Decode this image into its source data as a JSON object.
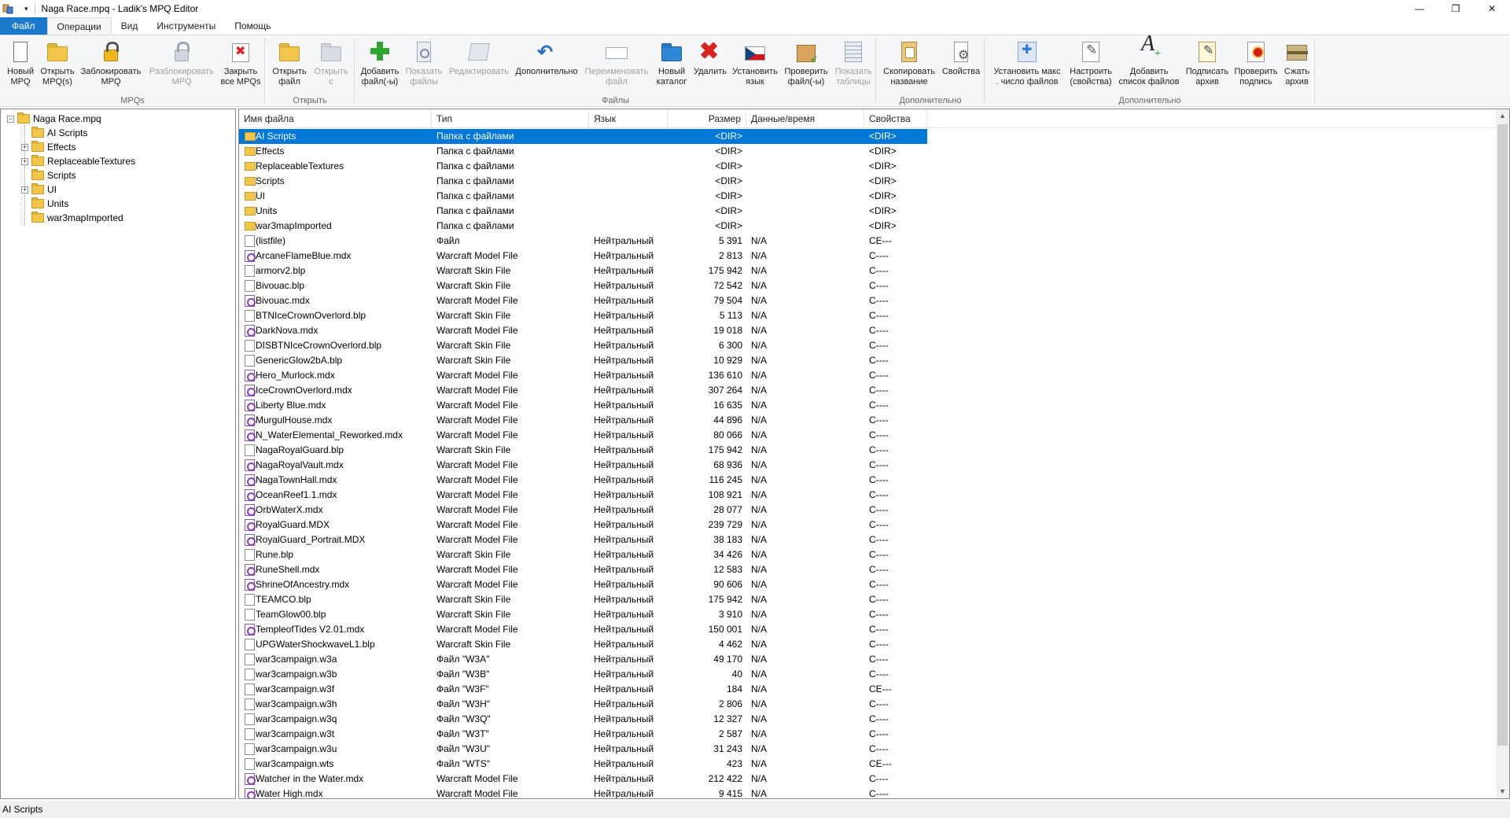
{
  "window": {
    "title": "Naga Race.mpq - Ladik's MPQ Editor",
    "controls": {
      "minimize": "—",
      "maximize": "❐",
      "close": "✕"
    }
  },
  "tabs": [
    "Файл",
    "Операции",
    "Вид",
    "Инструменты",
    "Помощь"
  ],
  "ribbon": {
    "groups": [
      {
        "label": "MPQs",
        "buttons": [
          {
            "label": "Новый\nMPQ",
            "icon": "new-mpq-icon",
            "disabled": false
          },
          {
            "label": "Открыть\nMPQ(s)",
            "icon": "open-mpq-icon",
            "disabled": false
          },
          {
            "label": "Заблокировать\nMPQ",
            "icon": "lock-icon",
            "disabled": false
          },
          {
            "label": "Разблокировать\nMPQ",
            "icon": "unlock-icon",
            "disabled": true
          },
          {
            "label": "Закрыть\nвсе MPQs",
            "icon": "close-all-icon",
            "disabled": false
          }
        ]
      },
      {
        "label": "Открыть",
        "buttons": [
          {
            "label": "Открыть\nфайл",
            "icon": "open-file-icon",
            "disabled": false
          },
          {
            "label": "Открыть\nс",
            "icon": "open-with-icon",
            "disabled": true
          }
        ]
      },
      {
        "label": "Файлы",
        "buttons": [
          {
            "label": "Добавить\nфайл(-ы)",
            "icon": "add-file-icon",
            "disabled": false
          },
          {
            "label": "Показать\nфайлы",
            "icon": "show-files-icon",
            "disabled": true
          },
          {
            "label": "Редактировать",
            "icon": "edit-icon",
            "disabled": true
          },
          {
            "label": "Дополнительно",
            "icon": "extra-icon",
            "disabled": false
          },
          {
            "label": "Переименовать\nфайл",
            "icon": "rename-icon",
            "disabled": true
          },
          {
            "label": "Новый\nкаталог",
            "icon": "new-folder-icon",
            "disabled": false
          },
          {
            "label": "Удалить",
            "icon": "delete-icon",
            "disabled": false
          },
          {
            "label": "Установить\nязык",
            "icon": "language-flag-icon",
            "disabled": false
          },
          {
            "label": "Проверить\nфайл(-ы)",
            "icon": "verify-files-icon",
            "disabled": false
          },
          {
            "label": "Показать\nтаблицы",
            "icon": "show-tables-icon",
            "disabled": true
          }
        ]
      },
      {
        "label": "Дополнительно",
        "buttons": [
          {
            "label": "Скопировать\nназвание",
            "icon": "copy-name-icon",
            "disabled": false
          },
          {
            "label": "Свойства",
            "icon": "properties-icon",
            "disabled": false
          }
        ]
      },
      {
        "label": "Дополнительно",
        "buttons": [
          {
            "label": "Установить макс\n. число файлов",
            "icon": "max-files-icon",
            "disabled": false
          },
          {
            "label": "Настроить\n(свойства)",
            "icon": "configure-icon",
            "disabled": false
          },
          {
            "label": "Добавить\nсписок файлов",
            "icon": "add-listfile-icon",
            "disabled": false
          },
          {
            "label": "Подписать\nархив",
            "icon": "sign-archive-icon",
            "disabled": false
          },
          {
            "label": "Проверить\nподпись",
            "icon": "verify-signature-icon",
            "disabled": false
          },
          {
            "label": "Сжать\nархив",
            "icon": "compact-archive-icon",
            "disabled": false
          }
        ]
      }
    ]
  },
  "tree": {
    "root": "Naga Race.mpq",
    "items": [
      {
        "label": "AI Scripts",
        "expandable": false
      },
      {
        "label": "Effects",
        "expandable": true
      },
      {
        "label": "ReplaceableTextures",
        "expandable": true
      },
      {
        "label": "Scripts",
        "expandable": false
      },
      {
        "label": "UI",
        "expandable": true
      },
      {
        "label": "Units",
        "expandable": false
      },
      {
        "label": "war3mapImported",
        "expandable": false
      }
    ]
  },
  "list": {
    "columns": [
      "Имя файла",
      "Тип",
      "Язык",
      "Размер",
      "Данные/время",
      "Свойства"
    ],
    "rows": [
      {
        "name": "AI Scripts",
        "type": "Папка с файлами",
        "lang": "",
        "size": "<DIR>",
        "date": "",
        "props": "<DIR>",
        "kind": "folder",
        "selected": true
      },
      {
        "name": "Effects",
        "type": "Папка с файлами",
        "lang": "",
        "size": "<DIR>",
        "date": "",
        "props": "<DIR>",
        "kind": "folder"
      },
      {
        "name": "ReplaceableTextures",
        "type": "Папка с файлами",
        "lang": "",
        "size": "<DIR>",
        "date": "",
        "props": "<DIR>",
        "kind": "folder"
      },
      {
        "name": "Scripts",
        "type": "Папка с файлами",
        "lang": "",
        "size": "<DIR>",
        "date": "",
        "props": "<DIR>",
        "kind": "folder"
      },
      {
        "name": "UI",
        "type": "Папка с файлами",
        "lang": "",
        "size": "<DIR>",
        "date": "",
        "props": "<DIR>",
        "kind": "folder"
      },
      {
        "name": "Units",
        "type": "Папка с файлами",
        "lang": "",
        "size": "<DIR>",
        "date": "",
        "props": "<DIR>",
        "kind": "folder"
      },
      {
        "name": "war3mapImported",
        "type": "Папка с файлами",
        "lang": "",
        "size": "<DIR>",
        "date": "",
        "props": "<DIR>",
        "kind": "folder"
      },
      {
        "name": "(listfile)",
        "type": "Файл",
        "lang": "Нейтральный",
        "size": "5 391",
        "date": "N/A",
        "props": "CE---",
        "kind": "file"
      },
      {
        "name": "ArcaneFlameBlue.mdx",
        "type": "Warcraft Model File",
        "lang": "Нейтральный",
        "size": "2 813",
        "date": "N/A",
        "props": "C----",
        "kind": "model"
      },
      {
        "name": "armorv2.blp",
        "type": "Warcraft Skin File",
        "lang": "Нейтральный",
        "size": "175 942",
        "date": "N/A",
        "props": "C----",
        "kind": "file"
      },
      {
        "name": "Bivouac.blp",
        "type": "Warcraft Skin File",
        "lang": "Нейтральный",
        "size": "72 542",
        "date": "N/A",
        "props": "C----",
        "kind": "file"
      },
      {
        "name": "Bivouac.mdx",
        "type": "Warcraft Model File",
        "lang": "Нейтральный",
        "size": "79 504",
        "date": "N/A",
        "props": "C----",
        "kind": "model"
      },
      {
        "name": "BTNIceCrownOverlord.blp",
        "type": "Warcraft Skin File",
        "lang": "Нейтральный",
        "size": "5 113",
        "date": "N/A",
        "props": "C----",
        "kind": "file"
      },
      {
        "name": "DarkNova.mdx",
        "type": "Warcraft Model File",
        "lang": "Нейтральный",
        "size": "19 018",
        "date": "N/A",
        "props": "C----",
        "kind": "model"
      },
      {
        "name": "DISBTNIceCrownOverlord.blp",
        "type": "Warcraft Skin File",
        "lang": "Нейтральный",
        "size": "6 300",
        "date": "N/A",
        "props": "C----",
        "kind": "file"
      },
      {
        "name": "GenericGlow2bA.blp",
        "type": "Warcraft Skin File",
        "lang": "Нейтральный",
        "size": "10 929",
        "date": "N/A",
        "props": "C----",
        "kind": "file"
      },
      {
        "name": "Hero_Murlock.mdx",
        "type": "Warcraft Model File",
        "lang": "Нейтральный",
        "size": "136 610",
        "date": "N/A",
        "props": "C----",
        "kind": "model"
      },
      {
        "name": "IceCrownOverlord.mdx",
        "type": "Warcraft Model File",
        "lang": "Нейтральный",
        "size": "307 264",
        "date": "N/A",
        "props": "C----",
        "kind": "model"
      },
      {
        "name": "Liberty Blue.mdx",
        "type": "Warcraft Model File",
        "lang": "Нейтральный",
        "size": "16 635",
        "date": "N/A",
        "props": "C----",
        "kind": "model"
      },
      {
        "name": "MurgulHouse.mdx",
        "type": "Warcraft Model File",
        "lang": "Нейтральный",
        "size": "44 896",
        "date": "N/A",
        "props": "C----",
        "kind": "model"
      },
      {
        "name": "N_WaterElemental_Reworked.mdx",
        "type": "Warcraft Model File",
        "lang": "Нейтральный",
        "size": "80 066",
        "date": "N/A",
        "props": "C----",
        "kind": "model"
      },
      {
        "name": "NagaRoyalGuard.blp",
        "type": "Warcraft Skin File",
        "lang": "Нейтральный",
        "size": "175 942",
        "date": "N/A",
        "props": "C----",
        "kind": "file"
      },
      {
        "name": "NagaRoyalVault.mdx",
        "type": "Warcraft Model File",
        "lang": "Нейтральный",
        "size": "68 936",
        "date": "N/A",
        "props": "C----",
        "kind": "model"
      },
      {
        "name": "NagaTownHall.mdx",
        "type": "Warcraft Model File",
        "lang": "Нейтральный",
        "size": "116 245",
        "date": "N/A",
        "props": "C----",
        "kind": "model"
      },
      {
        "name": "OceanReef1.1.mdx",
        "type": "Warcraft Model File",
        "lang": "Нейтральный",
        "size": "108 921",
        "date": "N/A",
        "props": "C----",
        "kind": "model"
      },
      {
        "name": "OrbWaterX.mdx",
        "type": "Warcraft Model File",
        "lang": "Нейтральный",
        "size": "28 077",
        "date": "N/A",
        "props": "C----",
        "kind": "model"
      },
      {
        "name": "RoyalGuard.MDX",
        "type": "Warcraft Model File",
        "lang": "Нейтральный",
        "size": "239 729",
        "date": "N/A",
        "props": "C----",
        "kind": "model"
      },
      {
        "name": "RoyalGuard_Portrait.MDX",
        "type": "Warcraft Model File",
        "lang": "Нейтральный",
        "size": "38 183",
        "date": "N/A",
        "props": "C----",
        "kind": "model"
      },
      {
        "name": "Rune.blp",
        "type": "Warcraft Skin File",
        "lang": "Нейтральный",
        "size": "34 426",
        "date": "N/A",
        "props": "C----",
        "kind": "file"
      },
      {
        "name": "RuneShell.mdx",
        "type": "Warcraft Model File",
        "lang": "Нейтральный",
        "size": "12 583",
        "date": "N/A",
        "props": "C----",
        "kind": "model"
      },
      {
        "name": "ShrineOfAncestry.mdx",
        "type": "Warcraft Model File",
        "lang": "Нейтральный",
        "size": "90 606",
        "date": "N/A",
        "props": "C----",
        "kind": "model"
      },
      {
        "name": "TEAMCO.blp",
        "type": "Warcraft Skin File",
        "lang": "Нейтральный",
        "size": "175 942",
        "date": "N/A",
        "props": "C----",
        "kind": "file"
      },
      {
        "name": "TeamGlow00.blp",
        "type": "Warcraft Skin File",
        "lang": "Нейтральный",
        "size": "3 910",
        "date": "N/A",
        "props": "C----",
        "kind": "file"
      },
      {
        "name": "TempleofTides V2.01.mdx",
        "type": "Warcraft Model File",
        "lang": "Нейтральный",
        "size": "150 001",
        "date": "N/A",
        "props": "C----",
        "kind": "model"
      },
      {
        "name": "UPGWaterShockwaveL1.blp",
        "type": "Warcraft Skin File",
        "lang": "Нейтральный",
        "size": "4 462",
        "date": "N/A",
        "props": "C----",
        "kind": "file"
      },
      {
        "name": "war3campaign.w3a",
        "type": "Файл \"W3A\"",
        "lang": "Нейтральный",
        "size": "49 170",
        "date": "N/A",
        "props": "C----",
        "kind": "file"
      },
      {
        "name": "war3campaign.w3b",
        "type": "Файл \"W3B\"",
        "lang": "Нейтральный",
        "size": "40",
        "date": "N/A",
        "props": "C----",
        "kind": "file"
      },
      {
        "name": "war3campaign.w3f",
        "type": "Файл \"W3F\"",
        "lang": "Нейтральный",
        "size": "184",
        "date": "N/A",
        "props": "CE---",
        "kind": "file"
      },
      {
        "name": "war3campaign.w3h",
        "type": "Файл \"W3H\"",
        "lang": "Нейтральный",
        "size": "2 806",
        "date": "N/A",
        "props": "C----",
        "kind": "file"
      },
      {
        "name": "war3campaign.w3q",
        "type": "Файл \"W3Q\"",
        "lang": "Нейтральный",
        "size": "12 327",
        "date": "N/A",
        "props": "C----",
        "kind": "file"
      },
      {
        "name": "war3campaign.w3t",
        "type": "Файл \"W3T\"",
        "lang": "Нейтральный",
        "size": "2 587",
        "date": "N/A",
        "props": "C----",
        "kind": "file"
      },
      {
        "name": "war3campaign.w3u",
        "type": "Файл \"W3U\"",
        "lang": "Нейтральный",
        "size": "31 243",
        "date": "N/A",
        "props": "C----",
        "kind": "file"
      },
      {
        "name": "war3campaign.wts",
        "type": "Файл \"WTS\"",
        "lang": "Нейтральный",
        "size": "423",
        "date": "N/A",
        "props": "CE---",
        "kind": "file"
      },
      {
        "name": "Watcher in the Water.mdx",
        "type": "Warcraft Model File",
        "lang": "Нейтральный",
        "size": "212 422",
        "date": "N/A",
        "props": "C----",
        "kind": "model"
      },
      {
        "name": "Water High.mdx",
        "type": "Warcraft Model File",
        "lang": "Нейтральный",
        "size": "9 415",
        "date": "N/A",
        "props": "C----",
        "kind": "model"
      }
    ]
  },
  "statusbar": {
    "text": "AI Scripts"
  },
  "colors": {
    "accent": "#0078d7",
    "file_tab": "#1979ca",
    "ribbon_bg": "#f5f6f7"
  }
}
